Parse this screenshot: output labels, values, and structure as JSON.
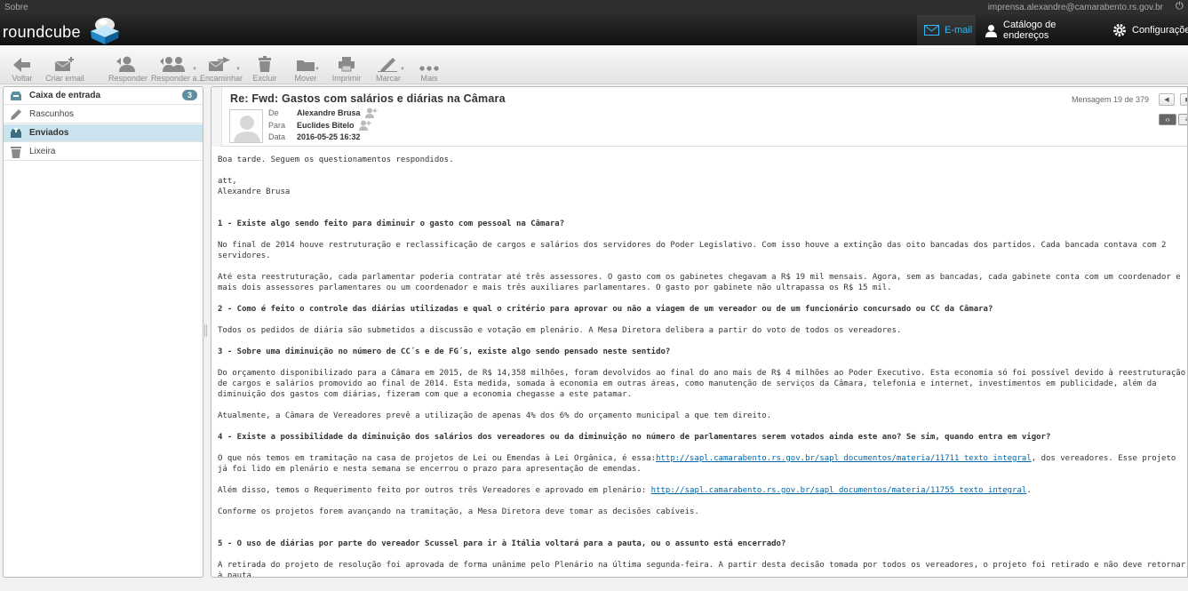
{
  "topbar": {
    "about": "Sobre",
    "user_email": "imprensa.alexandre@camarabento.rs.gov.br"
  },
  "logo": {
    "text": "roundcube"
  },
  "tasks": [
    {
      "label": "E-mail",
      "icon": "envelope-icon",
      "active": true
    },
    {
      "label": "Catálogo de endereços",
      "icon": "person-icon"
    },
    {
      "label": "Configurações",
      "icon": "gear-icon"
    }
  ],
  "toolbar": {
    "back": "Voltar",
    "compose": "Criar email",
    "reply": "Responder",
    "reply_all": "Responder a...",
    "forward": "Encaminhar",
    "delete": "Excluir",
    "move": "Mover",
    "print": "Imprimir",
    "mark": "Marcar",
    "more": "Mais"
  },
  "folders": [
    {
      "name": "Caixa de entrada",
      "unread": "3",
      "icon": "inbox-icon",
      "bold": true
    },
    {
      "name": "Rascunhos",
      "icon": "pencil-icon"
    },
    {
      "name": "Enviados",
      "icon": "sent-icon",
      "bold": true,
      "selected": true
    },
    {
      "name": "Lixeira",
      "icon": "trash-icon"
    }
  ],
  "message": {
    "subject": "Re: Fwd: Gastos com salários e diárias na Câmara",
    "from_label": "De",
    "from": "Alexandre Brusa",
    "to_label": "Para",
    "to": "Euclides Bitelo",
    "date_label": "Data",
    "date": "2016-05-25 16:32",
    "counter": "Mensagem 19 de 379",
    "body": {
      "greeting": "Boa tarde. Seguem os questionamentos respondidos.",
      "signoff1": "att,",
      "signoff2": "Alexandre Brusa",
      "q1": "1 - Existe algo sendo feito para diminuir o gasto com pessoal na Câmara?",
      "a1p1": "No final de 2014 houve restruturação e reclassificação de cargos e salários dos servidores do Poder Legislativo. Com isso houve a extinção das oito bancadas dos partidos. Cada bancada contava com 2 servidores.",
      "a1p2": "Até esta reestruturação, cada parlamentar poderia contratar até três assessores. O gasto com os gabinetes chegavam a R$ 19 mil mensais. Agora, sem as bancadas, cada gabinete conta com um coordenador e mais dois assessores parlamentares ou um coordenador e mais três auxiliares parlamentares. O gasto por gabinete não ultrapassa os R$ 15 mil.",
      "q2": "2 - Como é feito o controle das diárias utilizadas e qual o critério para aprovar ou não a viagem de um vereador ou de um funcionário concursado ou CC da Câmara?",
      "a2": "Todos os pedidos de diária são submetidos a discussão e votação em plenário. A Mesa Diretora delibera a partir do voto de todos os vereadores.",
      "q3": "3 - Sobre uma diminuição no número de CC´s e de FG´s, existe algo sendo pensado neste sentido?",
      "a3p1": "Do orçamento disponibilizado para a Câmara em 2015, de R$ 14,358 milhões, foram devolvidos ao final do ano mais de R$ 4 milhões ao Poder Executivo. Esta economia só foi possível devido à reestruturação de cargos e salários promovido ao final de 2014. Esta medida, somada à economia em outras áreas, como manutenção de serviços da Câmara, telefonia e internet, investimentos em publicidade, além da diminuição dos gastos com diárias, fizeram com que a economia chegasse a este patamar.",
      "a3p2": "Atualmente, a Câmara de Vereadores prevê a utilização de apenas 4% dos 6% do orçamento municipal a que tem direito.",
      "q4": "4 - Existe a possibilidade da diminuição dos salários dos vereadores ou da diminuição no número de parlamentares serem votados ainda este ano? Se sim, quando entra em vigor?",
      "a4p1_pre": "O que nós temos em tramitação na casa de projetos de Lei ou Emendas à Lei Orgânica, é essa:",
      "a4p1_link": "http://sapl.camarabento.rs.gov.br/sapl_documentos/materia/11711_texto_integral",
      "a4p1_post": ", dos vereadores. Esse projeto já foi lido em plenário e nesta semana se encerrou o prazo para apresentação de emendas.",
      "a4p2_pre": "Além disso, temos o Requerimento feito por outros três Vereadores e aprovado em plenário: ",
      "a4p2_link": "http://sapl.camarabento.rs.gov.br/sapl_documentos/materia/11755_texto_integral",
      "a4p2_post": ".",
      "a4p3": "Conforme os projetos forem avançando na tramitação, a Mesa Diretora deve tomar as decisões cabíveis.",
      "q5": "5 - O uso de diárias por parte do vereador Scussel para ir à Itália voltará para a pauta, ou o assunto está encerrado?",
      "a5": "A retirada do projeto de resolução foi aprovada de forma unânime pelo Plenário na última segunda-feira. A partir desta decisão tomada por todos os vereadores, o projeto foi retirado e não deve retornar à pauta."
    }
  }
}
